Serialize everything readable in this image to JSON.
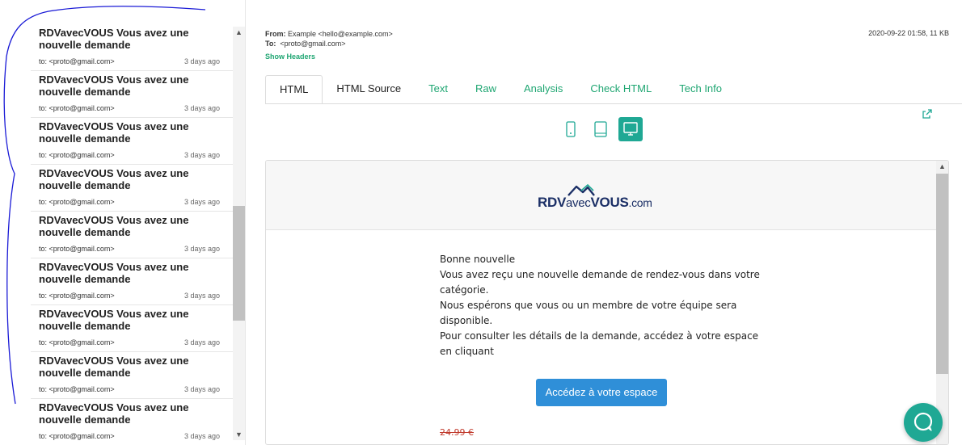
{
  "inbox": {
    "messages": [
      {
        "subject": "RDVavecVOUS Vous avez une nouvelle demande",
        "to": "to: <proto@gmail.com>",
        "time": "3 days ago"
      },
      {
        "subject": "RDVavecVOUS Vous avez une nouvelle demande",
        "to": "to: <proto@gmail.com>",
        "time": "3 days ago"
      },
      {
        "subject": "RDVavecVOUS Vous avez une nouvelle demande",
        "to": "to: <proto@gmail.com>",
        "time": "3 days ago"
      },
      {
        "subject": "RDVavecVOUS Vous avez une nouvelle demande",
        "to": "to: <proto@gmail.com>",
        "time": "3 days ago"
      },
      {
        "subject": "RDVavecVOUS Vous avez une nouvelle demande",
        "to": "to: <proto@gmail.com>",
        "time": "3 days ago"
      },
      {
        "subject": "RDVavecVOUS Vous avez une nouvelle demande",
        "to": "to: <proto@gmail.com>",
        "time": "3 days ago"
      },
      {
        "subject": "RDVavecVOUS Vous avez une nouvelle demande",
        "to": "to: <proto@gmail.com>",
        "time": "3 days ago"
      },
      {
        "subject": "RDVavecVOUS Vous avez une nouvelle demande",
        "to": "to: <proto@gmail.com>",
        "time": "3 days ago"
      },
      {
        "subject": "RDVavecVOUS Vous avez une nouvelle demande",
        "to": "to: <proto@gmail.com>",
        "time": "3 days ago"
      }
    ]
  },
  "header": {
    "from_label": "From:",
    "from_value": "Example <hello@example.com>",
    "to_label": "To:",
    "to_value": "<proto@gmail.com>",
    "show_headers": "Show Headers",
    "meta": "2020-09-22 01:58, 11 KB"
  },
  "tabs": [
    "HTML",
    "HTML Source",
    "Text",
    "Raw",
    "Analysis",
    "Check HTML",
    "Tech Info"
  ],
  "preview": {
    "logo": {
      "part1": "RDV",
      "part2": "avec",
      "part3": "VOUS",
      "part4": ".com"
    },
    "lines": [
      "Bonne nouvelle",
      "Vous avez reçu une nouvelle demande de rendez-vous dans votre",
      "catégorie.",
      "Nous espérons que vous ou un membre de votre équipe sera",
      "disponible.",
      "Pour consulter les détails de la demande, accédez à votre espace",
      "en cliquant"
    ],
    "cta": "Accédez à votre espace",
    "price": "24.99 €"
  },
  "colors": {
    "accent": "#1fa894",
    "link": "#1fa672",
    "cta": "#2f8fd8",
    "logo": "#1b2f66"
  },
  "icons": [
    "mobile-icon",
    "tablet-icon",
    "desktop-icon",
    "external-link-icon",
    "chat-icon"
  ]
}
